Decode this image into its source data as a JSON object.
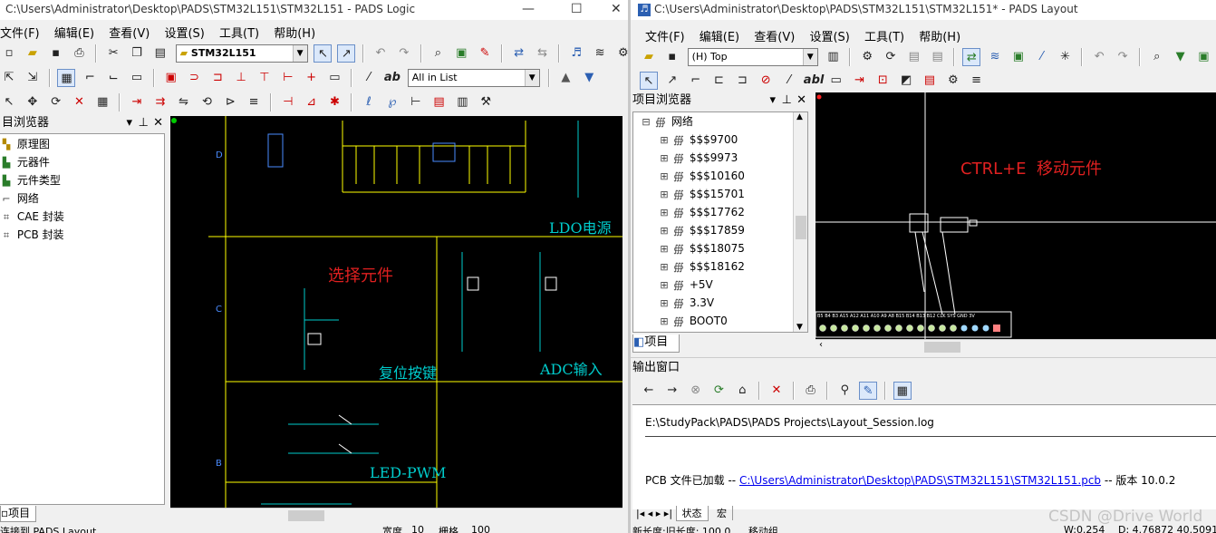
{
  "logic": {
    "title": "C:\\Users\\Administrator\\Desktop\\PADS\\STM32L151\\STM32L151 - PADS Logic",
    "menu": [
      "文件(F)",
      "编辑(E)",
      "查看(V)",
      "设置(S)",
      "工具(T)",
      "帮助(H)"
    ],
    "part_combo": "STM32L151",
    "filter_combo": "All in List",
    "project_panel_title": "目浏览器",
    "tree": [
      "原理图",
      "元器件",
      "元件类型",
      "网络",
      "CAE 封装",
      "PCB 封装"
    ],
    "project_tab": "项目",
    "sheet_labels": {
      "ldo": "LDO电源",
      "select": "选择元件",
      "reset": "复位按键",
      "adc": "ADC输入",
      "led": "LED-PWM"
    },
    "zone_letters": [
      "D",
      "C",
      "B"
    ],
    "status_left": "连接到 PADS Layout",
    "status_w": "宽度",
    "status_w_val": "10",
    "status_g": "栅格",
    "status_g_val": "100"
  },
  "layout": {
    "title": "C:\\Users\\Administrator\\Desktop\\PADS\\STM32L151\\STM32L151* - PADS Layout",
    "menu": [
      "文件(F)",
      "编辑(E)",
      "查看(V)",
      "设置(S)",
      "工具(T)",
      "帮助(H)"
    ],
    "layer_combo": "(H) Top",
    "project_panel_title": "项目浏览器",
    "tree_root": "网络",
    "nets": [
      "$$$9700",
      "$$$9973",
      "$$$10160",
      "$$$15701",
      "$$$17762",
      "$$$17859",
      "$$$18075",
      "$$$18162",
      "+5V",
      "3.3V",
      "BOOT0"
    ],
    "project_tab": "项目",
    "canvas_annotation": "CTRL+E  移动元件",
    "output_title": "输出窗口",
    "log_line1": "E:\\StudyPack\\PADS\\PADS Projects\\Layout_Session.log",
    "log_line2_prefix": "PCB 文件已加载  --",
    "log_link": "C:\\Users\\Administrator\\Desktop\\PADS\\STM32L151\\STM32L151.pcb",
    "log_line2_suffix": "-- 版本  10.0.2",
    "tab_status": "状态",
    "tab_macro": "宏",
    "status_new_len": "新长度:旧长度: 100.0",
    "status_move": "移动组",
    "status_w": "W:0.254",
    "status_coord": "D: 4.76872 40.50919",
    "watermark": "CSDN @Drive World",
    "header_pins": "B5 B4 B3 A15 A12 A11 A10 A9 A8 B15 B14 B13 B12 CLK SYS GND 3V"
  }
}
